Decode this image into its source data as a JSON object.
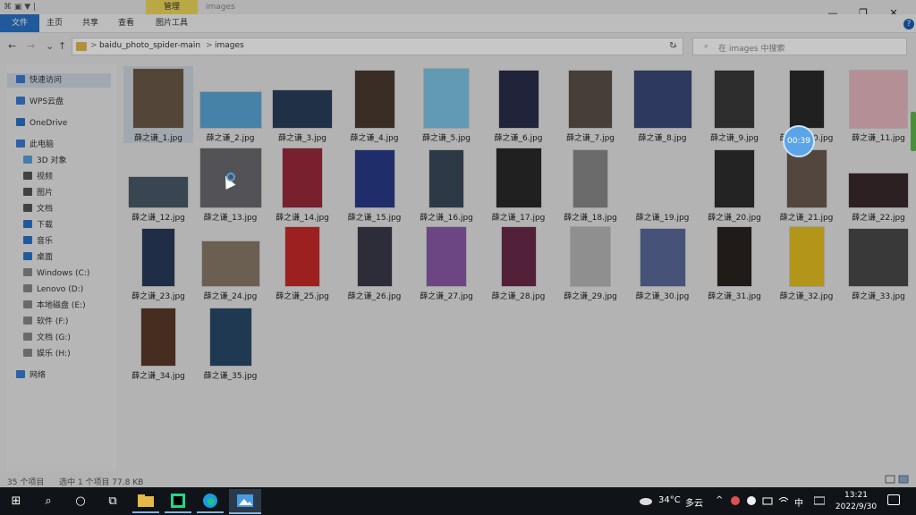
{
  "titlebar": {
    "manage_tab": "管理",
    "window_title": "images",
    "quick_access_toolbar": "⌘ ▣ ▼ |",
    "minimize": "—",
    "maximize": "❐",
    "close": "✕",
    "help": "?"
  },
  "ribbon": {
    "file": "文件",
    "home": "主页",
    "share": "共享",
    "view": "查看",
    "picture_tools": "图片工具"
  },
  "nav": {
    "back": "←",
    "forward": "→",
    "recent": "⌄",
    "up": "↑"
  },
  "address": {
    "sep1": ">",
    "crumb1": "baidu_photo_spider-main",
    "sep2": ">",
    "crumb2": "images",
    "dropdown": "⌄",
    "refresh": "↻"
  },
  "search": {
    "icon": "⌕",
    "placeholder": "在 images 中搜索"
  },
  "sidebar": {
    "items": [
      {
        "label": "快速访问",
        "icon": "star-icon",
        "color": "#3a7bd5"
      },
      {
        "label": "WPS云盘",
        "icon": "cloud-icon",
        "color": "#3a7bd5"
      },
      {
        "label": "OneDrive",
        "icon": "cloud-icon",
        "color": "#2b74c7"
      },
      {
        "label": "此电脑",
        "icon": "computer-icon",
        "color": "#3a7bd5"
      },
      {
        "label": "3D 对象",
        "icon": "cube-icon",
        "color": "#5aa0d8"
      },
      {
        "label": "视频",
        "icon": "video-icon",
        "color": "#555"
      },
      {
        "label": "图片",
        "icon": "picture-icon",
        "color": "#555"
      },
      {
        "label": "文档",
        "icon": "document-icon",
        "color": "#555"
      },
      {
        "label": "下载",
        "icon": "download-icon",
        "color": "#2b74c7"
      },
      {
        "label": "音乐",
        "icon": "music-icon",
        "color": "#2b74c7"
      },
      {
        "label": "桌面",
        "icon": "desktop-icon",
        "color": "#2b74c7"
      },
      {
        "label": "Windows (C:)",
        "icon": "drive-icon",
        "color": "#888"
      },
      {
        "label": "Lenovo (D:)",
        "icon": "drive-icon",
        "color": "#888"
      },
      {
        "label": "本地磁盘 (E:)",
        "icon": "drive-icon",
        "color": "#888"
      },
      {
        "label": "软件 (F:)",
        "icon": "drive-icon",
        "color": "#888"
      },
      {
        "label": "文档 (G:)",
        "icon": "drive-icon",
        "color": "#888"
      },
      {
        "label": "娱乐 (H:)",
        "icon": "drive-icon",
        "color": "#888"
      },
      {
        "label": "网络",
        "icon": "network-icon",
        "color": "#3a7bd5"
      }
    ]
  },
  "files": [
    {
      "name": "薛之谦_1.jpg",
      "color": "#6b5a4a"
    },
    {
      "name": "薛之谦_2.jpg",
      "color": "#5aa7d6"
    },
    {
      "name": "薛之谦_3.jpg",
      "color": "#2a3e5a"
    },
    {
      "name": "薛之谦_4.jpg",
      "color": "#4a3a30"
    },
    {
      "name": "薛之谦_5.jpg",
      "color": "#7fc6e6"
    },
    {
      "name": "薛之谦_6.jpg",
      "color": "#2a2e4a"
    },
    {
      "name": "薛之谦_7.jpg",
      "color": "#5a5048"
    },
    {
      "name": "薛之谦_8.jpg",
      "color": "#3a4a7a"
    },
    {
      "name": "薛之谦_9.jpg",
      "color": "#3a3a3a"
    },
    {
      "name": "薛之谦_10.jpg",
      "color": "#2a2a2a"
    },
    {
      "name": "薛之谦_11.jpg",
      "color": "#e8b8c0"
    },
    {
      "name": "薛之谦_12.jpg",
      "color": "#4a5a6a"
    },
    {
      "name": "薛之谦_13.jpg",
      "color": "#6a6a70"
    },
    {
      "name": "薛之谦_14.jpg",
      "color": "#9a2a3a"
    },
    {
      "name": "薛之谦_15.jpg",
      "color": "#2a3a8a"
    },
    {
      "name": "薛之谦_16.jpg",
      "color": "#3a4a5a"
    },
    {
      "name": "薛之谦_17.jpg",
      "color": "#2a2a2a"
    },
    {
      "name": "薛之谦_18.jpg",
      "color": "#8a8a8a"
    },
    {
      "name": "薛之谦_19.jpg",
      "color": "#ffffff"
    },
    {
      "name": "薛之谦_20.jpg",
      "color": "#2e2e2e"
    },
    {
      "name": "薛之谦_21.jpg",
      "color": "#6a5a50"
    },
    {
      "name": "薛之谦_22.jpg",
      "color": "#3a2a2e"
    },
    {
      "name": "薛之谦_23.jpg",
      "color": "#2a3a5a"
    },
    {
      "name": "薛之谦_24.jpg",
      "color": "#8a7a6a"
    },
    {
      "name": "薛之谦_25.jpg",
      "color": "#c82a2a"
    },
    {
      "name": "薛之谦_26.jpg",
      "color": "#3a3a4a"
    },
    {
      "name": "薛之谦_27.jpg",
      "color": "#8a5aa8"
    },
    {
      "name": "薛之谦_28.jpg",
      "color": "#6a2a4a"
    },
    {
      "name": "薛之谦_29.jpg",
      "color": "#b8b8b8"
    },
    {
      "name": "薛之谦_30.jpg",
      "color": "#5a6a9a"
    },
    {
      "name": "薛之谦_31.jpg",
      "color": "#2a2220"
    },
    {
      "name": "薛之谦_32.jpg",
      "color": "#e6c020"
    },
    {
      "name": "薛之谦_33.jpg",
      "color": "#4a4a4a"
    },
    {
      "name": "薛之谦_34.jpg",
      "color": "#5a3a2a"
    },
    {
      "name": "薛之谦_35.jpg",
      "color": "#2a4a6a"
    }
  ],
  "status": {
    "count": "35 个项目",
    "selection": "选中 1 个项目  77.8 KB"
  },
  "overlay": {
    "timer": "00:39"
  },
  "taskbar": {
    "start": "⊞",
    "search": "⌕",
    "cortana": "○",
    "taskview": "⧉",
    "weather_temp": "34°C",
    "weather_text": "多云",
    "tray_chevron": "^",
    "ime": "中",
    "time": "13:21",
    "date": "2022/9/30"
  }
}
